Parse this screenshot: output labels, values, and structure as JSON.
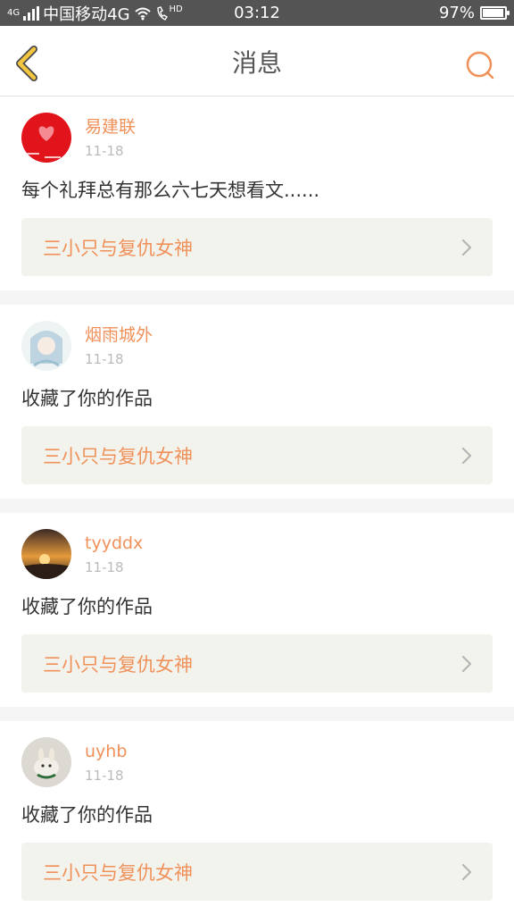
{
  "status_bar": {
    "network_small": "4G",
    "carrier": "中国移动4G",
    "hd_label": "HD",
    "time": "03:12",
    "battery": "97%",
    "battery_level": 0.97
  },
  "header": {
    "title": "消息",
    "back_icon": "chevron-left-icon",
    "search_icon": "search-icon"
  },
  "messages": [
    {
      "username": "易建联",
      "time": "11-18",
      "text": "每个礼拜总有那么六七天想看文......",
      "work_title": "三小只与复仇女神"
    },
    {
      "username": "烟雨城外",
      "time": "11-18",
      "text": "收藏了你的作品",
      "work_title": "三小只与复仇女神"
    },
    {
      "username": "tyyddx",
      "time": "11-18",
      "text": "收藏了你的作品",
      "work_title": "三小只与复仇女神"
    },
    {
      "username": "uyhb",
      "time": "11-18",
      "text": "收藏了你的作品",
      "work_title": "三小只与复仇女神"
    }
  ],
  "colors": {
    "accent": "#f0915a",
    "back_icon": "#f3c640",
    "status_bar_bg": "#545454"
  }
}
